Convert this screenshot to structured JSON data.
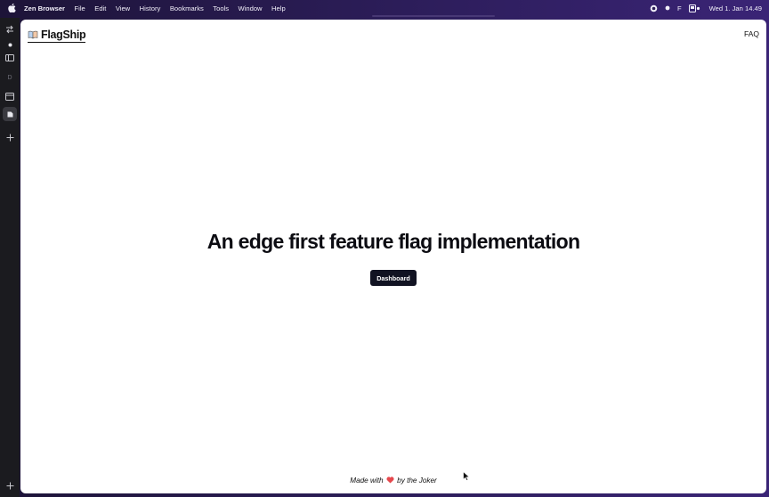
{
  "menubar": {
    "app_name": "Zen Browser",
    "menus": [
      "File",
      "Edit",
      "View",
      "History",
      "Bookmarks",
      "Tools",
      "Window",
      "Help"
    ],
    "status_letter": "F",
    "clock": "Wed 1. Jan  14.49"
  },
  "sidebar": {
    "icons": [
      "swap-icon",
      "dot-icon",
      "sidebar-panel-icon",
      "letter-d-icon",
      "calendar-icon",
      "flag-tab-icon",
      "new-tab-plus-icon",
      "bottom-plus-icon"
    ],
    "tab_letter": "D"
  },
  "page": {
    "logo_text": "FlagShip",
    "nav_faq": "FAQ",
    "hero_title": "An edge first feature flag implementation",
    "dashboard_label": "Dashboard",
    "footer_before": "Made with",
    "footer_after": "by the Joker",
    "heart_color": "#e5484d"
  }
}
